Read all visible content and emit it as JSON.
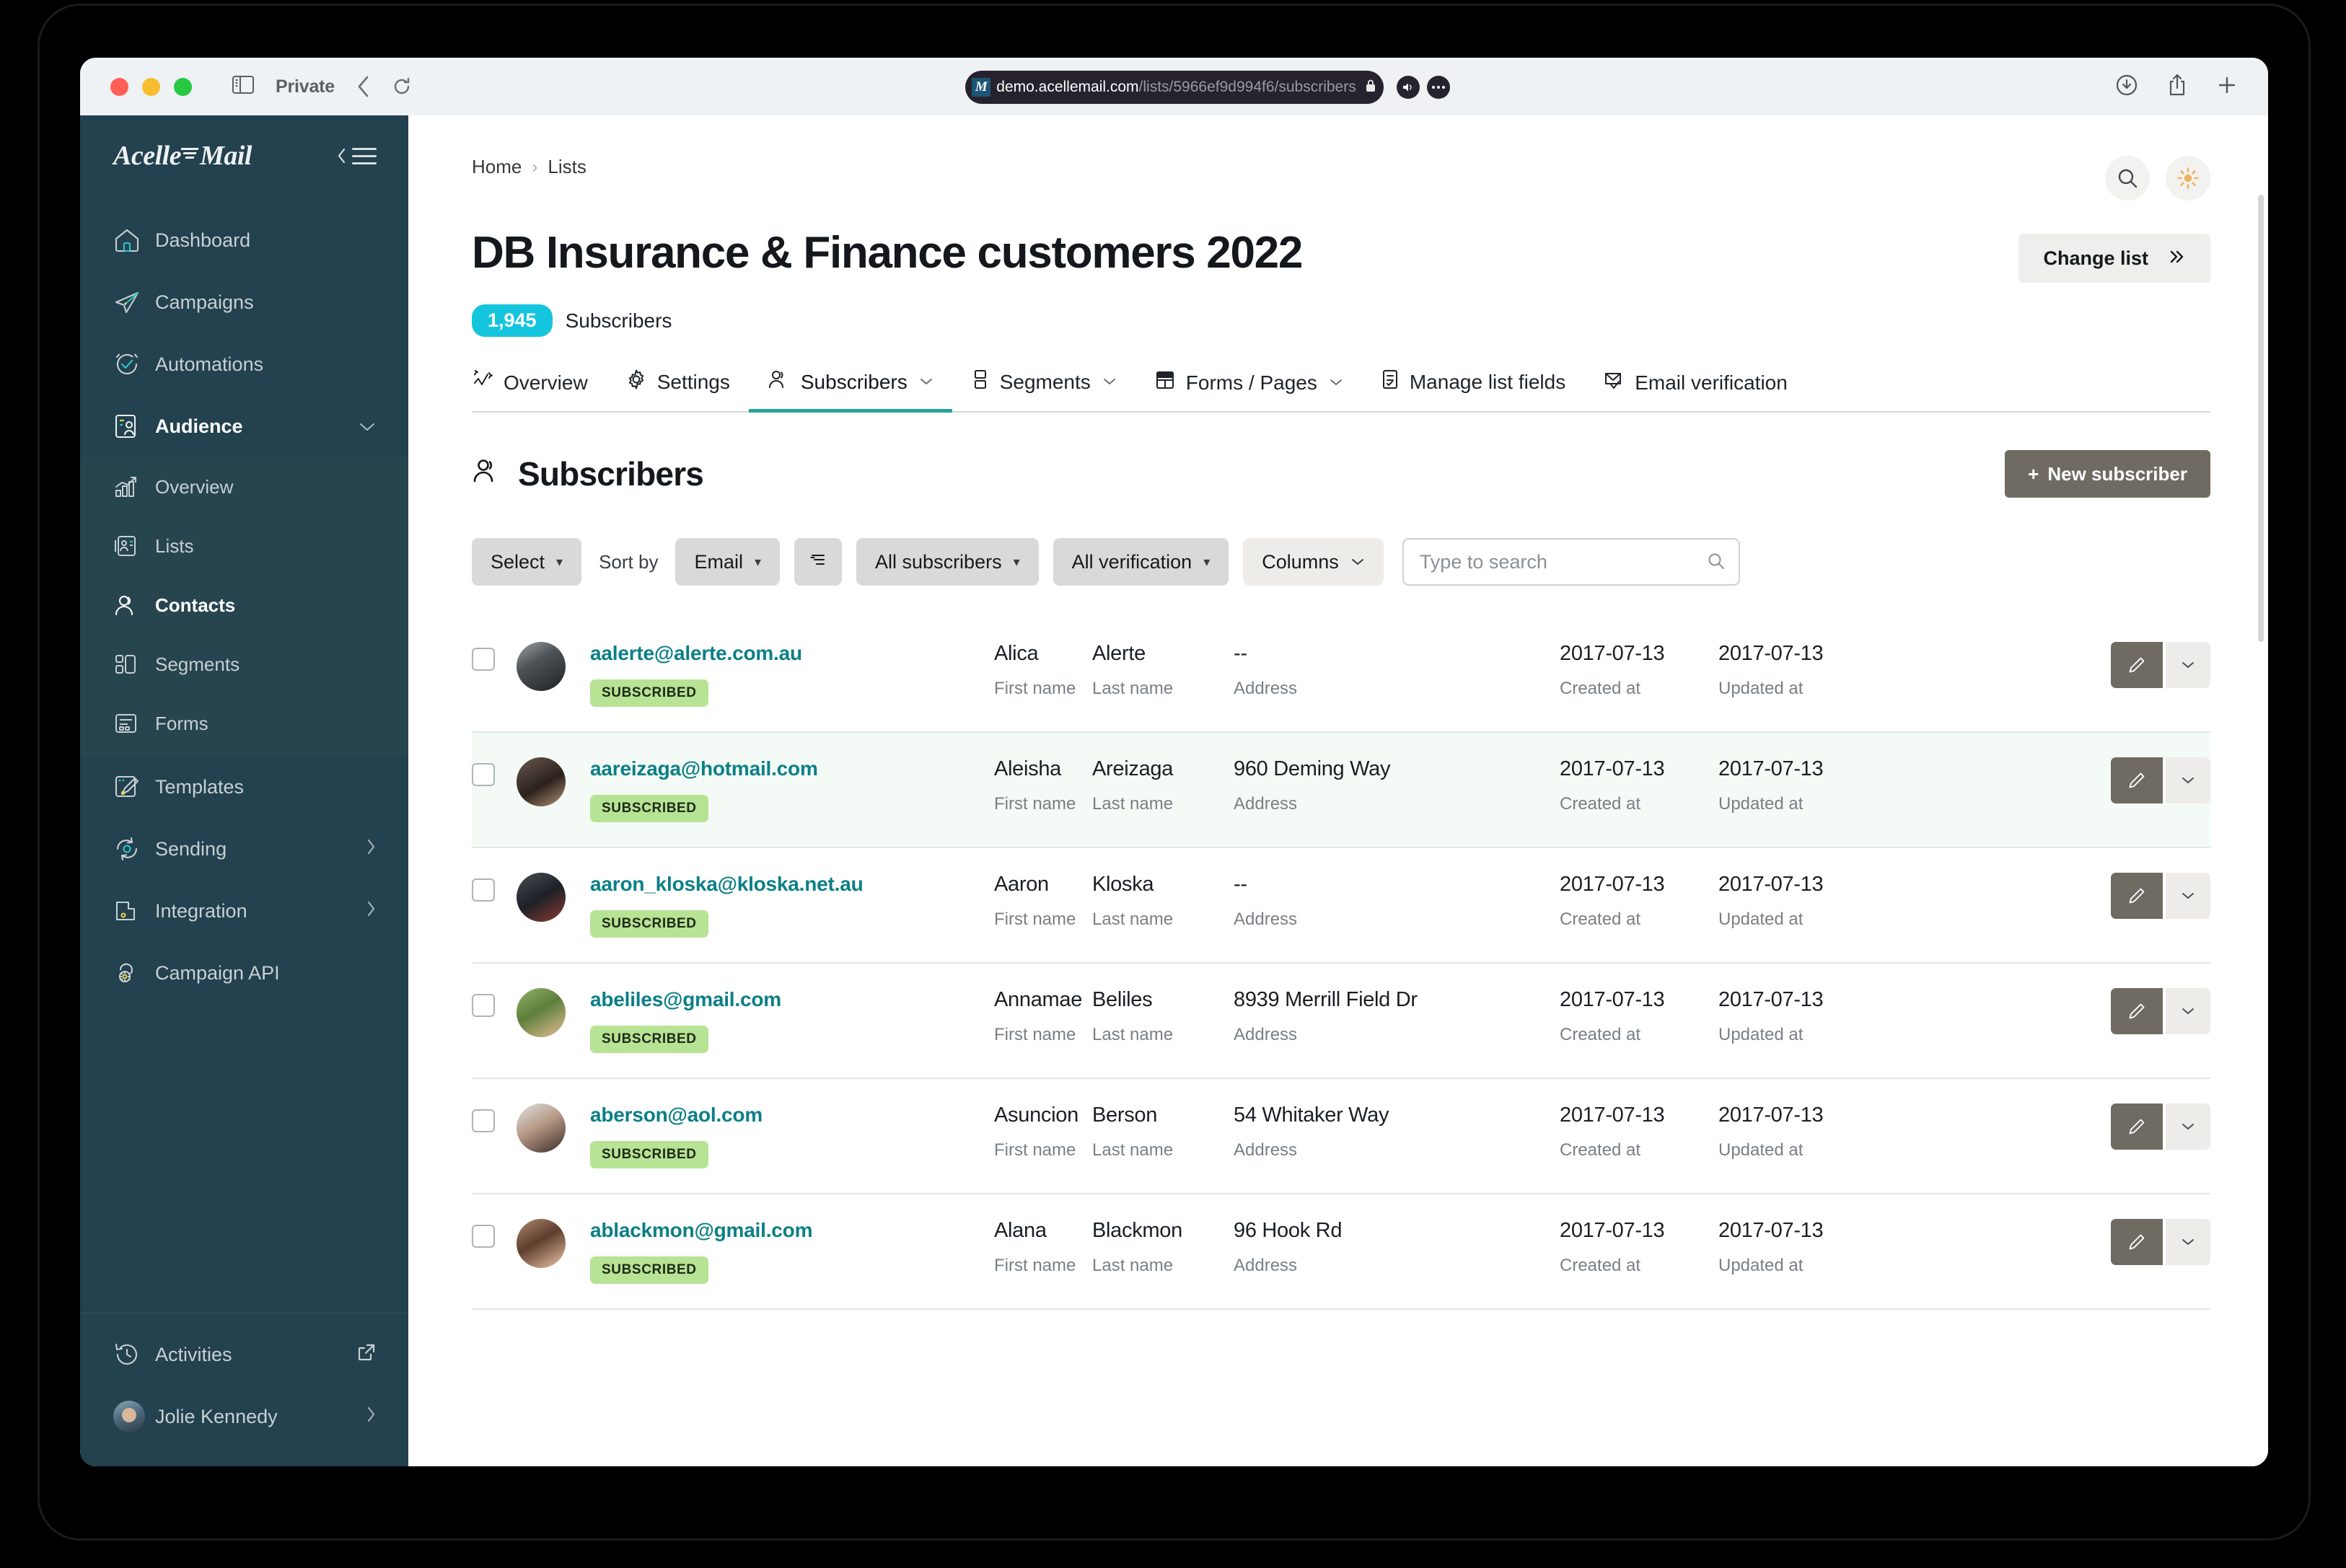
{
  "browser": {
    "private_label": "Private",
    "url_host": "demo.acellemail.com",
    "url_path": "/lists/5966ef9d994f6/subscribers",
    "favicon_letter": "M",
    "back_icon": "chevron-left-icon",
    "reload_icon": "reload-icon",
    "sidebar_icon": "sidebar-toggle-icon",
    "download_icon": "download-icon",
    "share_icon": "share-icon",
    "newtab_icon": "plus-icon",
    "audio_icon": "speaker-icon",
    "more_icon": "ellipsis-icon",
    "lock_icon": "lock-icon"
  },
  "sidebar": {
    "brand": "AcelleMail",
    "brand_part1": "Acelle",
    "brand_part2": "Mail",
    "collapse_icon": "collapse-sidebar-icon",
    "items": [
      {
        "label": "Dashboard",
        "icon": "home-icon",
        "chevron": ""
      },
      {
        "label": "Campaigns",
        "icon": "paper-plane-icon",
        "chevron": ""
      },
      {
        "label": "Automations",
        "icon": "check-circle-icon",
        "chevron": ""
      },
      {
        "label": "Audience",
        "icon": "audience-icon",
        "chevron": "down"
      }
    ],
    "sub_items": [
      {
        "label": "Overview",
        "icon": "chart-bar-icon"
      },
      {
        "label": "Lists",
        "icon": "list-card-icon"
      },
      {
        "label": "Contacts",
        "icon": "user-icon"
      },
      {
        "label": "Segments",
        "icon": "segments-icon"
      },
      {
        "label": "Forms",
        "icon": "form-icon"
      }
    ],
    "items_after": [
      {
        "label": "Templates",
        "icon": "template-brush-icon",
        "chevron": ""
      },
      {
        "label": "Sending",
        "icon": "sync-gear-icon",
        "chevron": "right"
      },
      {
        "label": "Integration",
        "icon": "integration-icon",
        "chevron": "right"
      },
      {
        "label": "Campaign API",
        "icon": "api-gear-icon",
        "chevron": ""
      }
    ],
    "bottom": [
      {
        "label": "Activities",
        "icon": "history-clock-icon",
        "chevron": "external"
      },
      {
        "label": "Jolie Kennedy",
        "icon": "avatar",
        "chevron": "right"
      }
    ]
  },
  "header": {
    "breadcrumb": [
      "Home",
      "Lists"
    ],
    "breadcrumb_sep": "›",
    "search_icon": "search-icon",
    "theme_icon": "sun-icon"
  },
  "page": {
    "title": "DB Insurance & Finance customers 2022",
    "change_list_label": "Change list",
    "change_list_icon": "double-chevron-right-icon",
    "count": "1,945",
    "count_label": "Subscribers"
  },
  "tabs": [
    {
      "label": "Overview",
      "icon": "activity-icon",
      "caret": false,
      "active": false
    },
    {
      "label": "Settings",
      "icon": "gear-icon",
      "caret": false,
      "active": false
    },
    {
      "label": "Subscribers",
      "icon": "users-icon",
      "caret": true,
      "active": true
    },
    {
      "label": "Segments",
      "icon": "segments-icon",
      "caret": true,
      "active": false
    },
    {
      "label": "Forms / Pages",
      "icon": "forms-pages-icon",
      "caret": true,
      "active": false
    },
    {
      "label": "Manage list fields",
      "icon": "list-fields-icon",
      "caret": false,
      "active": false
    },
    {
      "label": "Email verification",
      "icon": "envelope-check-icon",
      "caret": false,
      "active": false
    }
  ],
  "section": {
    "title": "Subscribers",
    "title_icon": "users-icon",
    "new_subscriber_label": "New subscriber",
    "new_subscriber_plus": "+"
  },
  "toolbar": {
    "select_label": "Select",
    "sort_by_label": "Sort by",
    "sort_field": "Email",
    "sort_direction_icon": "sort-asc-icon",
    "subscribers_filter": "All subscribers",
    "verification_filter": "All verification",
    "columns_label": "Columns",
    "search_placeholder": "Type to search",
    "search_value": "",
    "search_icon": "search-icon",
    "caret_icon": "caret-down-icon"
  },
  "table": {
    "field_labels": {
      "first_name": "First name",
      "last_name": "Last name",
      "address": "Address",
      "created_at": "Created at",
      "updated_at": "Updated at"
    },
    "status_label": "SUBSCRIBED",
    "edit_icon": "pencil-icon",
    "more_icon": "chevron-down-icon",
    "rows": [
      {
        "email": "aalerte@alerte.com.au",
        "status": "SUBSCRIBED",
        "first_name": "Alica",
        "last_name": "Alerte",
        "address": "--",
        "created_at": "2017-07-13",
        "updated_at": "2017-07-13",
        "tint": false,
        "avatar_colors": [
          "#8b8f93",
          "#2e3235",
          "#c8c9ca"
        ]
      },
      {
        "email": "aareizaga@hotmail.com",
        "status": "SUBSCRIBED",
        "first_name": "Aleisha",
        "last_name": "Areizaga",
        "address": "960 Deming Way",
        "created_at": "2017-07-13",
        "updated_at": "2017-07-13",
        "tint": true,
        "avatar_colors": [
          "#6d5a52",
          "#2a211d",
          "#b89176"
        ]
      },
      {
        "email": "aaron_kloska@kloska.net.au",
        "status": "SUBSCRIBED",
        "first_name": "Aaron",
        "last_name": "Kloska",
        "address": "--",
        "created_at": "2017-07-13",
        "updated_at": "2017-07-13",
        "tint": false,
        "avatar_colors": [
          "#4a4e56",
          "#1d2026",
          "#8d3b33"
        ]
      },
      {
        "email": "abeliles@gmail.com",
        "status": "SUBSCRIBED",
        "first_name": "Annamae",
        "last_name": "Beliles",
        "address": "8939 Merrill Field Dr",
        "created_at": "2017-07-13",
        "updated_at": "2017-07-13",
        "tint": false,
        "avatar_colors": [
          "#7d9b55",
          "#3f5a2a",
          "#e8bd96"
        ]
      },
      {
        "email": "aberson@aol.com",
        "status": "SUBSCRIBED",
        "first_name": "Asuncion",
        "last_name": "Berson",
        "address": "54 Whitaker Way",
        "created_at": "2017-07-13",
        "updated_at": "2017-07-13",
        "tint": false,
        "avatar_colors": [
          "#cfd2d4",
          "#3a2b25",
          "#f0cdb2"
        ]
      },
      {
        "email": "ablackmon@gmail.com",
        "status": "SUBSCRIBED",
        "first_name": "Alana",
        "last_name": "Blackmon",
        "address": "96 Hook Rd",
        "created_at": "2017-07-13",
        "updated_at": "2017-07-13",
        "tint": false,
        "avatar_colors": [
          "#9b7b63",
          "#4a3126",
          "#efc6a8"
        ]
      }
    ]
  },
  "colors": {
    "sidebar_bg": "#23414e",
    "accent_teal": "#27a396",
    "email_link": "#0b7f86",
    "badge_cyan": "#15c5dd",
    "status_green": "#b7e394",
    "button_brown": "#6f6a62"
  }
}
